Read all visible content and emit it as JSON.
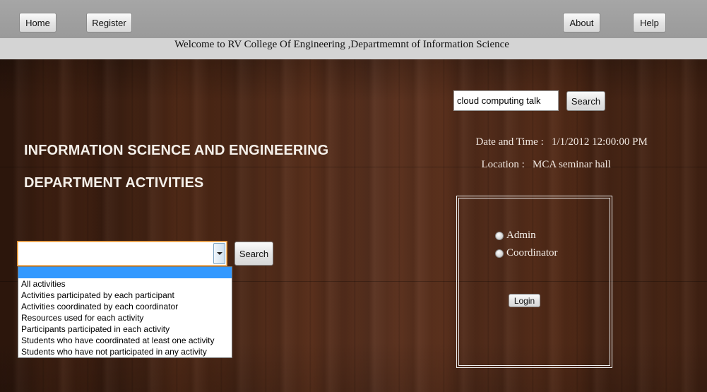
{
  "nav": {
    "home": "Home",
    "register": "Register",
    "about": "About",
    "help": "Help"
  },
  "welcome": "Welcome to RV College Of Engineering ,Departmemnt of Information Science",
  "top_search": {
    "value": "cloud computing talk",
    "button": "Search"
  },
  "event": {
    "date_label": "Date and Time :",
    "date_value": "1/1/2012 12:00:00 PM",
    "location_label": "Location :",
    "location_value": "MCA seminar hall"
  },
  "heading": {
    "line1": "INFORMATION SCIENCE AND ENGINEERING",
    "line2": "DEPARTMENT ACTIVITIES"
  },
  "activity_search": {
    "selected": "",
    "button": "Search",
    "options": [
      "",
      "All activities",
      "Activities participated by each participant",
      "Activities coordinated by each coordinator",
      "Resources used for each activity",
      "Participants participated in each activity",
      "Students who have coordinated at least one activity",
      "Students who have not participated in any activity"
    ]
  },
  "login": {
    "role_admin": "Admin",
    "role_coordinator": "Coordinator",
    "button": "Login"
  },
  "colors": {
    "nav_bar": "#9d9d9d",
    "welcome_strip": "#d4d4d4",
    "wood": "#4a2716",
    "selected_option": "#3399ff",
    "focus_border": "#e08a25"
  }
}
